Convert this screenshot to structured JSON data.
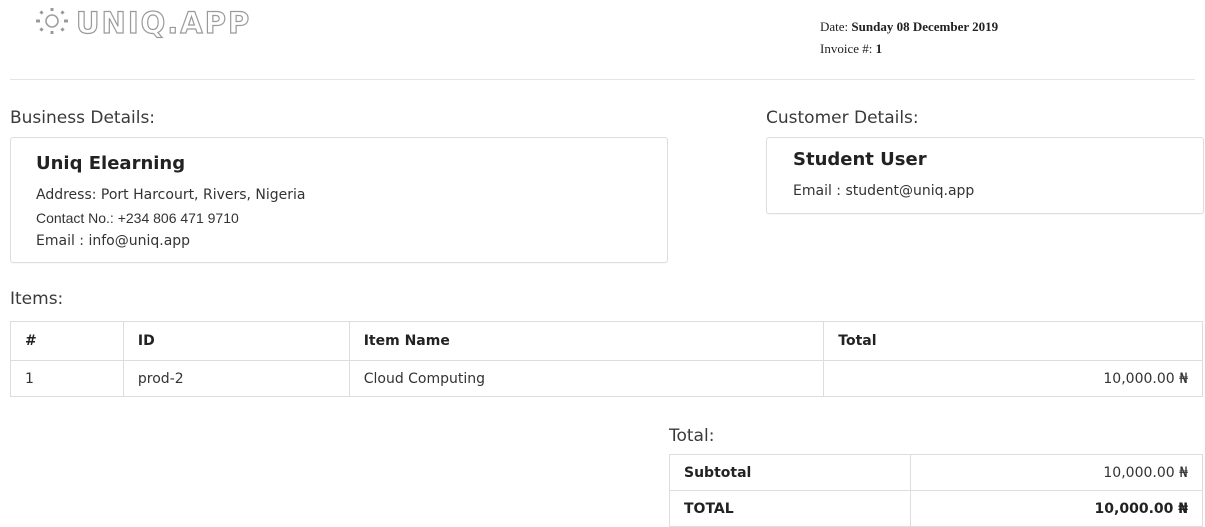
{
  "logo": {
    "text": "UNIQ.APP"
  },
  "meta": {
    "date_label": "Date:",
    "date_value": "Sunday 08 December 2019",
    "invoice_label": "Invoice #:",
    "invoice_value": "1"
  },
  "business": {
    "section_title": "Business Details:",
    "name": "Uniq Elearning",
    "address": "Address: Port Harcourt, Rivers, Nigeria",
    "contact": "Contact No.: +234 806 471 9710",
    "email": "Email : info@uniq.app"
  },
  "customer": {
    "section_title": "Customer Details:",
    "name": "Student User",
    "email": "Email : student@uniq.app"
  },
  "items": {
    "section_title": "Items:",
    "headers": [
      "#",
      "ID",
      "Item Name",
      "Total"
    ],
    "rows": [
      {
        "num": "1",
        "id": "prod-2",
        "name": "Cloud Computing",
        "total": "10,000.00 ₦"
      }
    ]
  },
  "totals": {
    "section_title": "Total:",
    "subtotal_label": "Subtotal",
    "subtotal_value": "10,000.00 ₦",
    "grand_label": "TOTAL",
    "grand_value": "10,000.00 ₦"
  }
}
